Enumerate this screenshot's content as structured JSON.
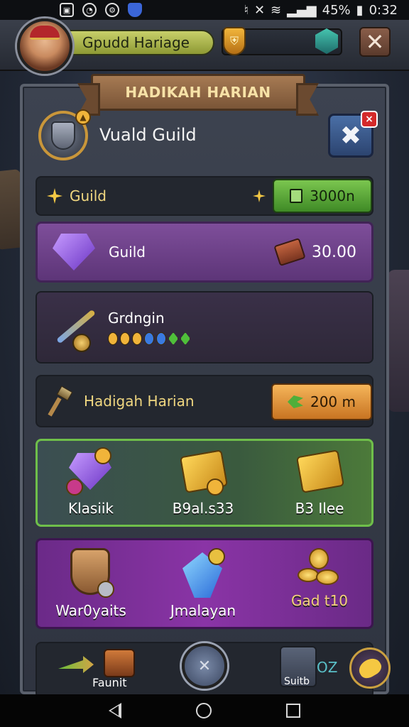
{
  "statusbar": {
    "battery": "45%",
    "time": "0:32"
  },
  "header": {
    "player_name": "Gpudd Hariage"
  },
  "panel": {
    "banner_title": "HADIKAH HARIAN",
    "guild_title": "Vuald Guild"
  },
  "row1": {
    "label": "Guild",
    "button_value": "3000n"
  },
  "row2": {
    "label": "Guild",
    "value": "30.00"
  },
  "row3": {
    "label": "Grdngin"
  },
  "row4": {
    "label": "Hadigah Harian",
    "button_value": "200 m"
  },
  "rewards_green": [
    {
      "label": "Klasiik"
    },
    {
      "label": "B9al.s33"
    },
    {
      "label": "B3 Ilee"
    }
  ],
  "rewards_violet": [
    {
      "label": "War0yaits"
    },
    {
      "label": "Jmalayan"
    },
    {
      "label": "Gad t10"
    }
  ],
  "bottom": {
    "chest_label": "Faunit",
    "suit_label": "Suitb",
    "xp_label": "OZ"
  },
  "colors": {
    "accent_green": "#6fbf4a",
    "accent_purple": "#7e4e9a",
    "accent_orange": "#f5b55a",
    "gold": "#f0d780"
  }
}
